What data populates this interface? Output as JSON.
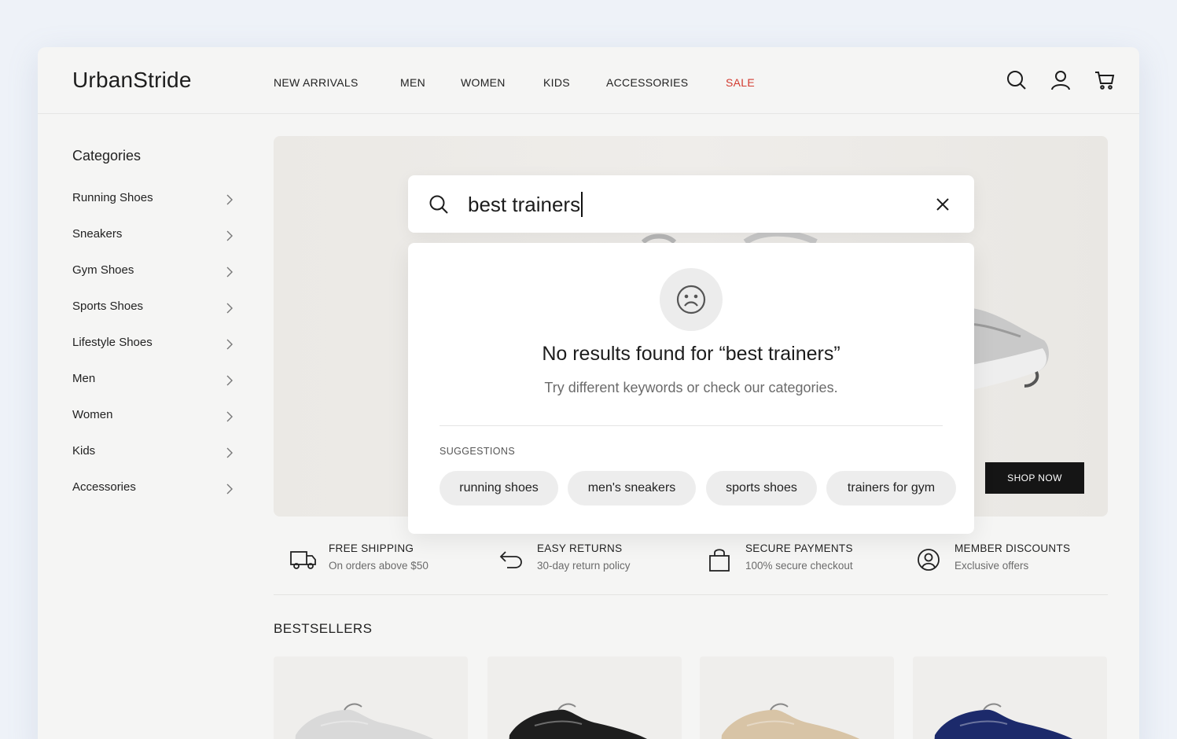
{
  "brand": "UrbanStride",
  "nav": [
    {
      "label": "NEW ARRIVALS"
    },
    {
      "label": "MEN"
    },
    {
      "label": "WOMEN"
    },
    {
      "label": "KIDS"
    },
    {
      "label": "ACCESSORIES"
    },
    {
      "label": "SALE",
      "accent": "#d23a2f"
    }
  ],
  "header_icons": [
    "search-icon",
    "user-icon",
    "cart-icon"
  ],
  "sidebar": {
    "title": "Categories",
    "items": [
      {
        "label": "Running Shoes"
      },
      {
        "label": "Sneakers"
      },
      {
        "label": "Gym Shoes"
      },
      {
        "label": "Sports Shoes"
      },
      {
        "label": "Lifestyle Shoes"
      },
      {
        "label": "Men"
      },
      {
        "label": "Women"
      },
      {
        "label": "Kids"
      },
      {
        "label": "Accessories"
      }
    ]
  },
  "hero": {
    "cta_label": "SHOP NOW"
  },
  "search": {
    "value": "best trainers",
    "no_results_title": "No results found for “best trainers”",
    "no_results_sub": "Try different keywords or check our categories.",
    "suggestions_label": "SUGGESTIONS",
    "suggestions": [
      "running shoes",
      "men's sneakers",
      "sports shoes",
      "trainers for gym"
    ]
  },
  "features": [
    {
      "icon": "truck-icon",
      "title": "FREE SHIPPING",
      "sub": "On orders above $50"
    },
    {
      "icon": "return-icon",
      "title": "EASY RETURNS",
      "sub": "30-day return policy"
    },
    {
      "icon": "bag-icon",
      "title": "SECURE PAYMENTS",
      "sub": "100% secure checkout"
    },
    {
      "icon": "member-icon",
      "title": "MEMBER DISCOUNTS",
      "sub": "Exclusive offers"
    }
  ],
  "bestsellers": {
    "title": "BESTSELLERS",
    "products": [
      {
        "color": "#d9d9d9"
      },
      {
        "color": "#1e1e1e"
      },
      {
        "color": "#d8c4a6"
      },
      {
        "color": "#1c2a6b"
      }
    ]
  },
  "colors": {
    "accent": "#d23a2f",
    "dark": "#151515",
    "page_bg": "#eef2f8"
  }
}
